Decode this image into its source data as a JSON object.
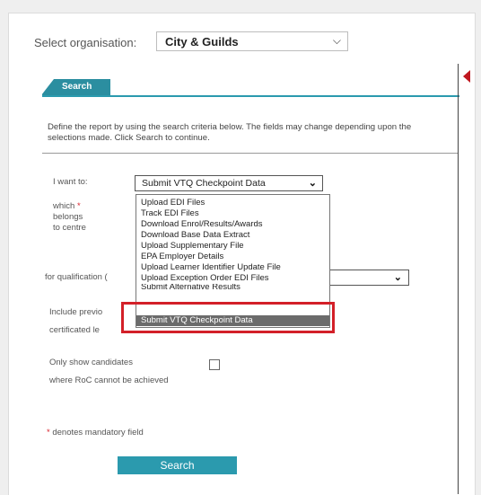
{
  "org": {
    "label": "Select organisation:",
    "value": "City & Guilds"
  },
  "tab": {
    "label": "Search"
  },
  "instructions": "Define the report by using the search criteria below. The fields may change depending upon the selections made. Click Search to continue.",
  "form": {
    "want_label": "I want to:",
    "want_value": "Submit VTQ Checkpoint Data",
    "which_label": "which",
    "belongs_label": "belongs",
    "centre_label": "to centre",
    "qual_label": "for qualification (",
    "include_label_1": "Include previo",
    "include_label_2": "certificated le",
    "only_show_1": "Only show candidates",
    "only_show_2": "where RoC cannot be achieved",
    "mandatory_note": "denotes mandatory field",
    "required_mark": "*"
  },
  "dropdown": {
    "options": [
      "Upload EDI Files",
      "Track EDI Files",
      "Download Enrol/Results/Awards",
      "Download Base Data Extract",
      "Upload Supplementary File",
      "EPA Employer Details",
      "Upload Learner Identifier Update File",
      "Upload Exception Order EDI Files",
      "Submit Alternative Results",
      "Submit VTQ Checkpoint Data"
    ],
    "selected": "Submit VTQ Checkpoint Data"
  },
  "search_button": "Search",
  "icons": {
    "select_chevron": "chevron-down-icon",
    "collapse_arrow": "caret-left-icon"
  },
  "colors": {
    "accent": "#2b9aae",
    "highlight": "#d32028",
    "selected_option": "#6b6b6b"
  }
}
